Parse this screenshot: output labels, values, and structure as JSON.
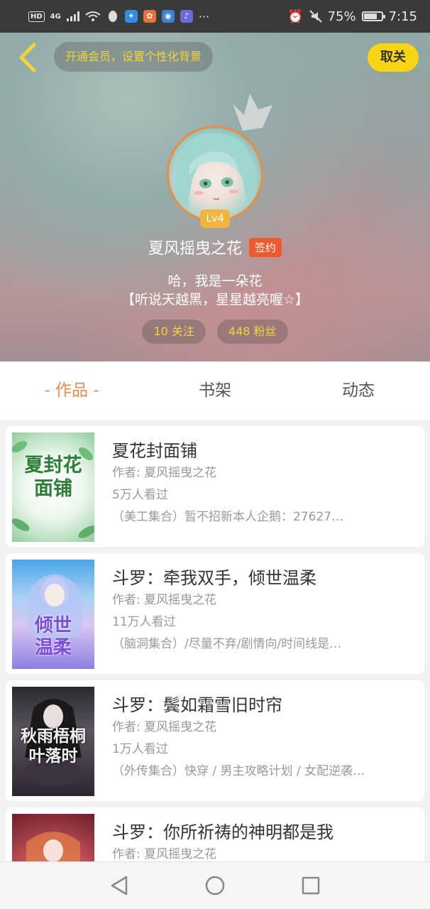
{
  "status_bar": {
    "hd": "HD",
    "signal": "4G",
    "battery": "75%",
    "time": "7:15",
    "more": "···",
    "battery_level": 0.75
  },
  "header": {
    "vip_prompt": "开通会员，设置个性化背景",
    "unfollow_label": "取关",
    "level": "Lv4",
    "username": "夏风摇曳之花",
    "signed_badge": "签约",
    "bio_line1": "哈，我是一朵花",
    "bio_line2": "【听说天越黑，星星越亮喔☆】",
    "following": "10 关注",
    "followers": "448 粉丝"
  },
  "tabs": [
    {
      "label": "- 作品 -",
      "active": true
    },
    {
      "label": "书架",
      "active": false
    },
    {
      "label": "动态",
      "active": false
    }
  ],
  "works": [
    {
      "title": "夏花封面铺",
      "author": "作者: 夏风摇曳之花",
      "views": "5万人看过",
      "desc": "（美工集合）暂不招新本人企鹅：27627…",
      "cover_text": "夏封花面铺",
      "cover_style": "green"
    },
    {
      "title": "斗罗：牵我双手，倾世温柔",
      "author": "作者: 夏风摇曳之花",
      "views": "11万人看过",
      "desc": "（脑洞集合）/尽量不弃/剧情向/时间线是…",
      "cover_text": "倾世温柔",
      "cover_style": "blue"
    },
    {
      "title": "斗罗：鬓如霜雪旧时帘",
      "author": "作者: 夏风摇曳之花",
      "views": "1万人看过",
      "desc": "（外传集合）快穿 / 男主攻略计划 / 女配逆袭…",
      "cover_text": "秋雨梧桐叶落时",
      "cover_style": "dark"
    },
    {
      "title": "斗罗：你所祈祷的神明都是我",
      "author": "作者: 夏风摇曳之花",
      "views": "",
      "desc": "",
      "cover_text": "",
      "cover_style": "red"
    }
  ],
  "colors": {
    "accent": "#ef8a50",
    "vip_text": "#f5d33a",
    "unfollow_bg": "#f7d515",
    "signed_bg": "#ec5a2e",
    "level_bg": "#f0b53d"
  },
  "icons": {
    "back": "back-chevron-icon",
    "crown": "crown-icon",
    "nav_back": "nav-back-icon",
    "nav_home": "nav-home-icon",
    "nav_recent": "nav-recent-icon"
  }
}
